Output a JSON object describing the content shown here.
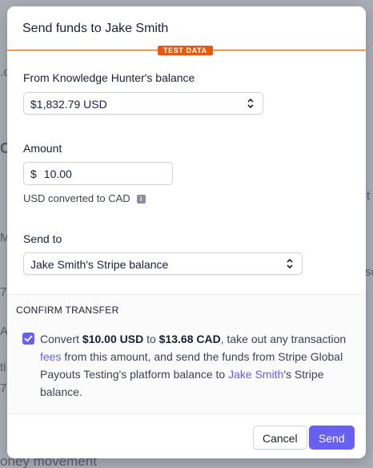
{
  "background": {
    "fragments": [
      "Mo",
      "7",
      "A",
      "7",
      "oney movement",
      "t",
      "so",
      "C",
      ".c",
      "ti"
    ]
  },
  "modal": {
    "title": "Send funds to Jake Smith",
    "test_badge": "TEST DATA",
    "from_label": "From Knowledge Hunter's balance",
    "from_value": "$1,832.79 USD",
    "amount_label": "Amount",
    "amount_currency": "$",
    "amount_value": "10.00",
    "conversion_note": "USD converted to CAD",
    "send_to_label": "Send to",
    "send_to_value": "Jake Smith's Stripe balance",
    "confirm": {
      "title": "CONFIRM TRANSFER",
      "checked": true,
      "text_1": "Convert ",
      "amount_from": "$10.00 USD",
      "text_2": " to ",
      "amount_to": "$13.68 CAD",
      "text_3": ", take out any transaction ",
      "fees_link": "fees",
      "text_4": " from this amount, and send the funds from Stripe Global Payouts Testing's platform balance to ",
      "recipient_link": "Jake Smith",
      "text_5": "'s Stripe balance."
    },
    "cancel_label": "Cancel",
    "send_label": "Send"
  },
  "colors": {
    "accent": "#635bff",
    "test_mode": "#e8590c"
  }
}
